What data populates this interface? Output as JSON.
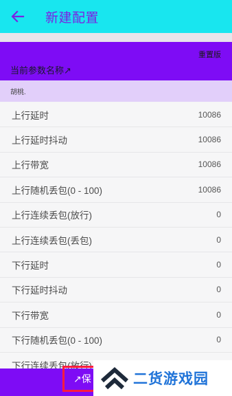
{
  "app_bar": {
    "back_icon": "arrow-left-icon",
    "title": "新建配置"
  },
  "header": {
    "reset_label": "重置版",
    "param_name_label": "当前参数名称↗"
  },
  "name_field": {
    "value": "胡桃."
  },
  "params": [
    {
      "label": "上行延时",
      "value": "10086"
    },
    {
      "label": "上行延时抖动",
      "value": "10086"
    },
    {
      "label": "上行带宽",
      "value": "10086"
    },
    {
      "label": "上行随机丢包(0 - 100)",
      "value": "10086"
    },
    {
      "label": "上行连续丢包(放行)",
      "value": "0"
    },
    {
      "label": "上行连续丢包(丢包)",
      "value": "0"
    },
    {
      "label": "下行延时",
      "value": "0"
    },
    {
      "label": "下行延时抖动",
      "value": "0"
    },
    {
      "label": "下行带宽",
      "value": "0"
    },
    {
      "label": "下行随机丢包(0 - 100)",
      "value": "0"
    },
    {
      "label": "下行连续丢包(放行)",
      "value": "0"
    }
  ],
  "bottom_bar": {
    "save_label": "↗保"
  },
  "watermark": {
    "text": "二货游戏园",
    "logo_icon": "double-chevron-up-logo-icon"
  },
  "colors": {
    "app_bar_bg": "#18e6ef",
    "accent_purple": "#7e0cf5",
    "title_purple": "#7a22e3",
    "name_row_bg": "#e2cffa",
    "save_border": "#ff1c3e",
    "watermark_blue": "#1f73d8"
  }
}
